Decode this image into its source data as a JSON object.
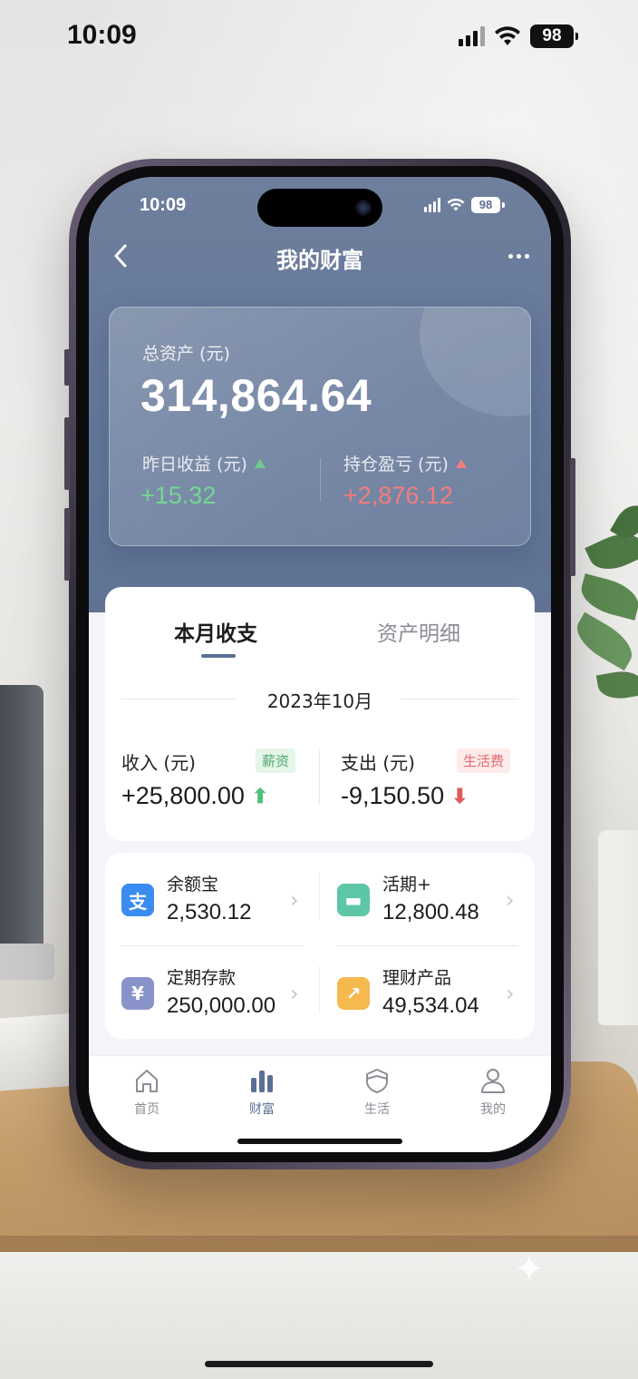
{
  "outer_status": {
    "time": "10:09",
    "battery": "98"
  },
  "inner_status": {
    "time": "10:09",
    "battery": "98"
  },
  "header": {
    "title": "我的财富",
    "back_icon": "chevron-left-icon",
    "more_icon": "more-dots-icon"
  },
  "assets": {
    "total_label": "总资产 (元)",
    "total_value": "314,864.64",
    "yesterday_label": "昨日收益 (元)",
    "yesterday_value": "+15.32",
    "holding_label": "持仓盈亏 (元)",
    "holding_value": "+2,876.12"
  },
  "tabs": [
    {
      "label": "本月收支",
      "active": true
    },
    {
      "label": "资产明细",
      "active": false
    }
  ],
  "month": {
    "date": "2023年10月",
    "income_label": "收入 (元)",
    "income_tag": "薪资",
    "income_value": "+25,800.00",
    "expense_label": "支出 (元)",
    "expense_tag": "生活费",
    "expense_value": "-9,150.50"
  },
  "accounts": [
    {
      "name": "余额宝",
      "value": "2,530.12",
      "icon": "alipay-icon",
      "icon_char": "支",
      "color": "#3b8cf0"
    },
    {
      "name": "活期+",
      "value": "12,800.48",
      "icon": "wallet-icon",
      "icon_char": "▬",
      "color": "#5cc6a6"
    },
    {
      "name": "定期存款",
      "value": "250,000.00",
      "icon": "deposit-icon",
      "icon_char": "¥",
      "color": "#8a93c9"
    },
    {
      "name": "理财产品",
      "value": "49,534.04",
      "icon": "chart-growth-icon",
      "icon_char": "↗",
      "color": "#f5b94e"
    }
  ],
  "tabbar": [
    {
      "label": "首页",
      "icon": "home-icon",
      "active": false
    },
    {
      "label": "财富",
      "icon": "bar-chart-icon",
      "active": true
    },
    {
      "label": "生活",
      "icon": "shield-icon",
      "active": false
    },
    {
      "label": "我的",
      "icon": "user-icon",
      "active": false
    }
  ],
  "colors": {
    "accent": "#5a6f96",
    "gain": "#6fcf8a",
    "loss": "#f08080"
  }
}
